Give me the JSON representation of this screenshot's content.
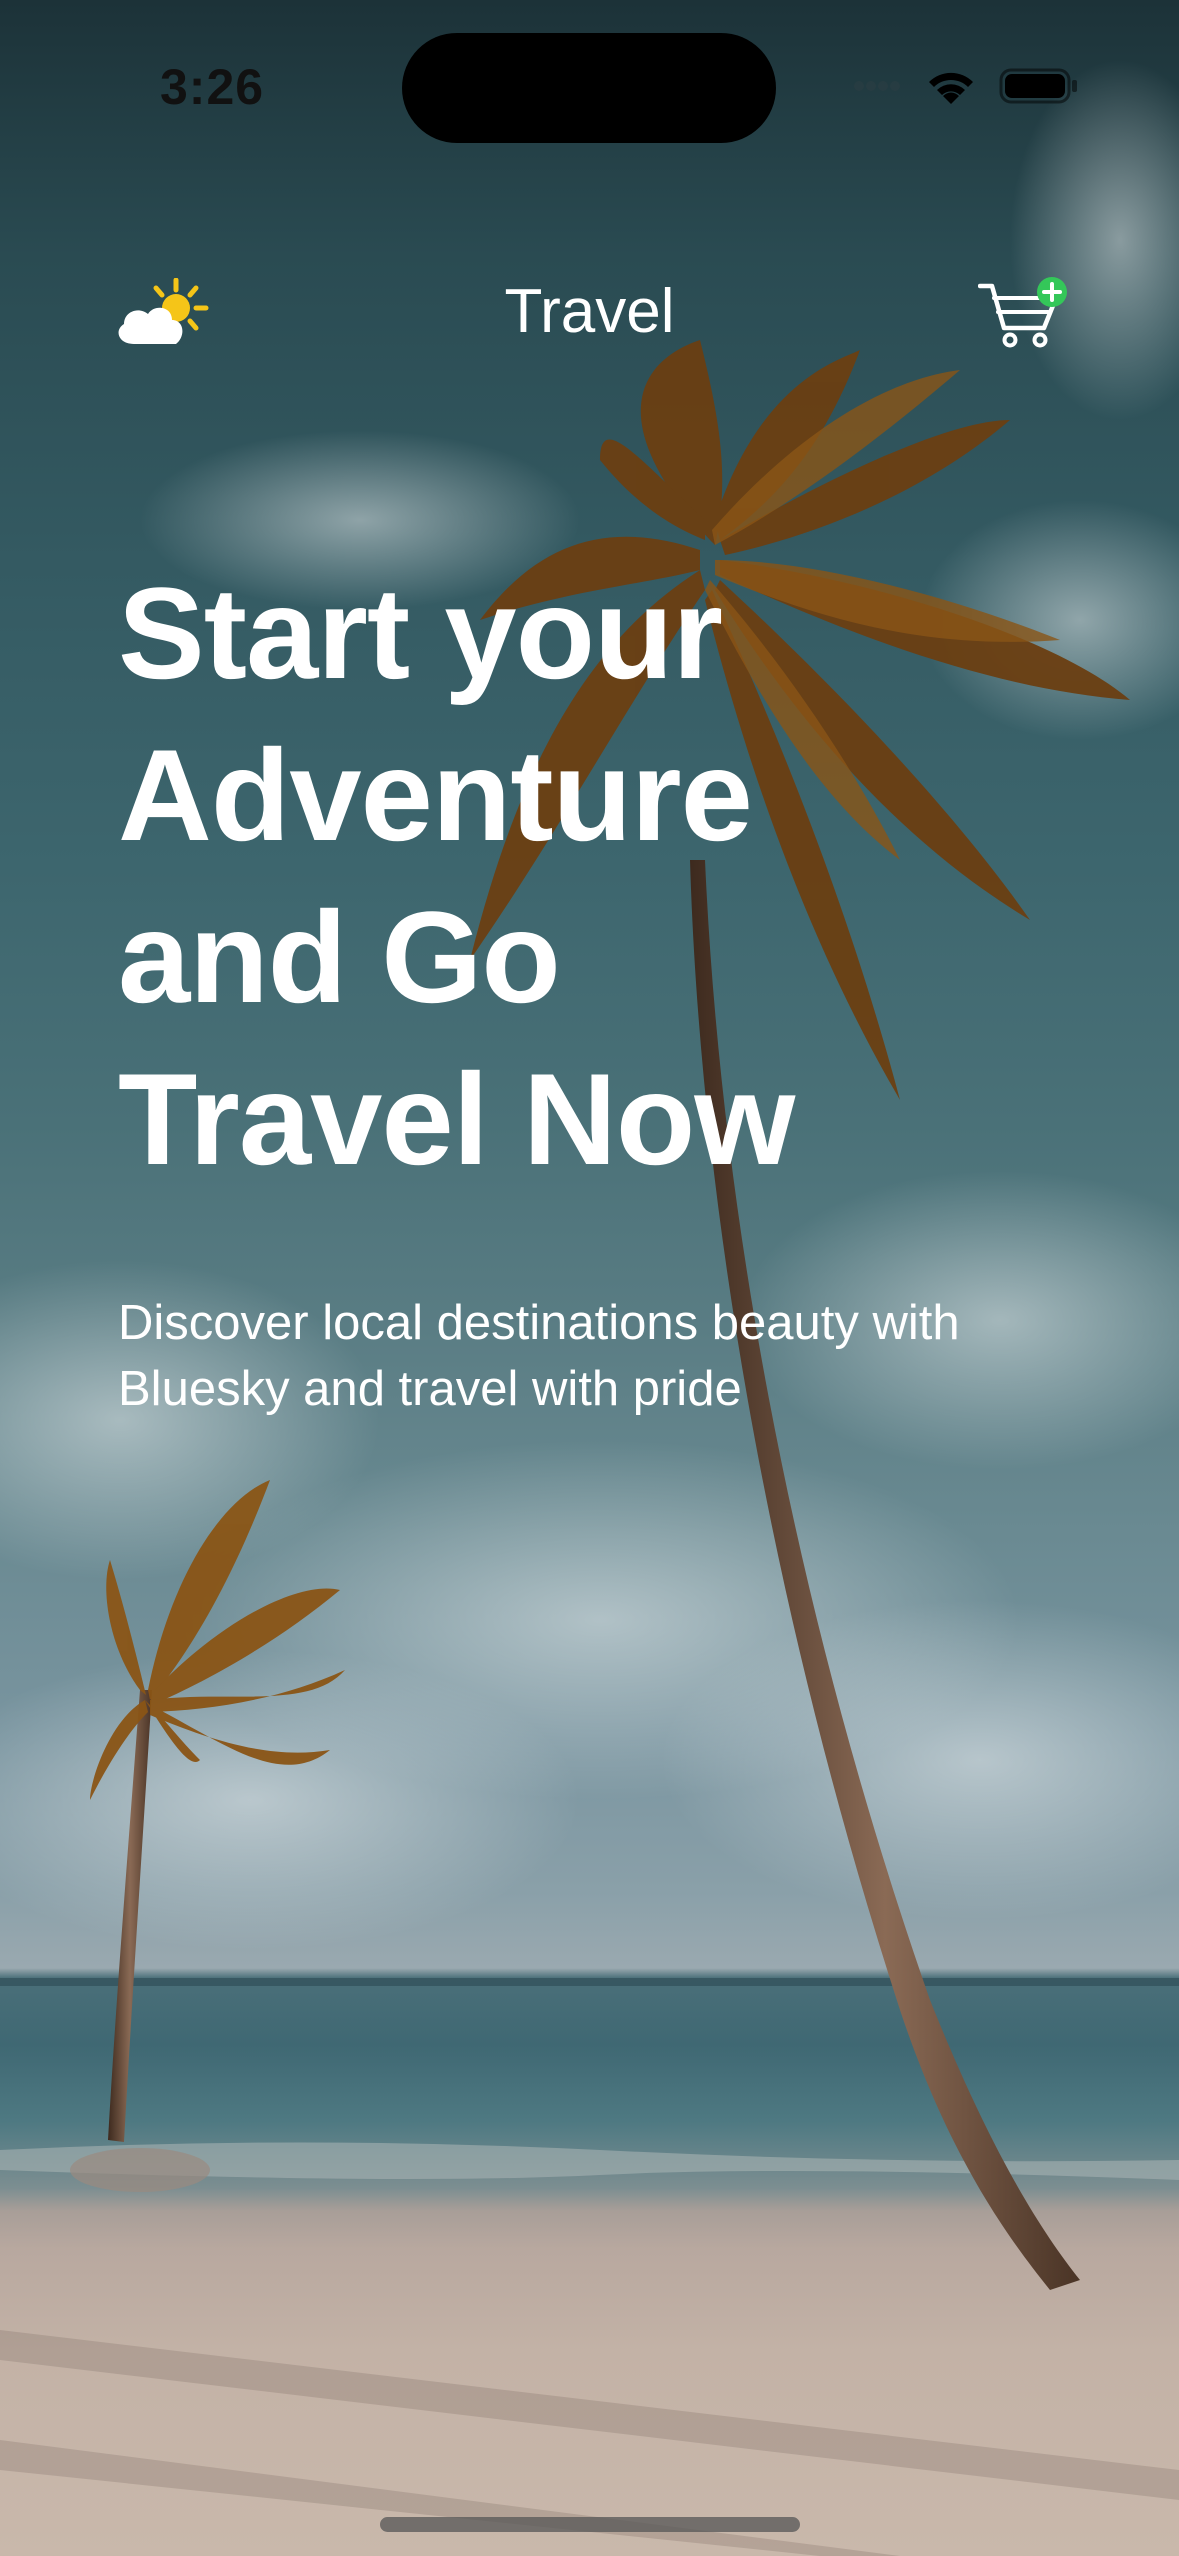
{
  "status_bar": {
    "time": "3:26"
  },
  "nav": {
    "title": "Travel",
    "left_icon": "weather-partly-sunny-icon",
    "right_icon": "cart-add-icon"
  },
  "hero": {
    "headline_lines": [
      "Start your",
      "Adventure",
      "and Go",
      "Travel Now"
    ],
    "subtitle_lines": [
      "Discover local destinations beauty with",
      "Bluesky and travel with pride"
    ]
  },
  "colors": {
    "text": "#ffffff",
    "sun": "#f5c518",
    "badge": "#34c759"
  }
}
